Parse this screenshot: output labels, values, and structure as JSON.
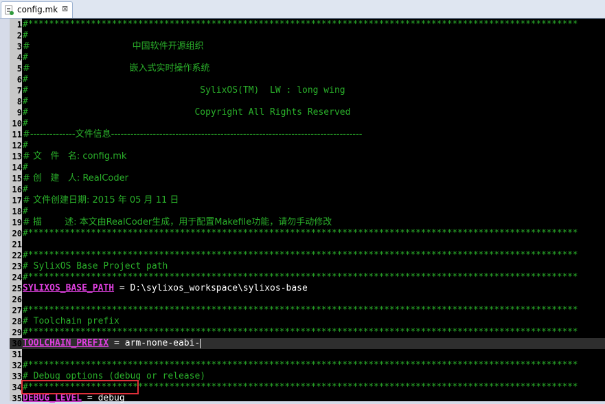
{
  "tab": {
    "title": "config.mk",
    "close": "⊠"
  },
  "lines": [
    {
      "n": "1",
      "kind": "stars",
      "text": "#*********************************************************************************************************"
    },
    {
      "n": "2",
      "kind": "comment",
      "text": "#"
    },
    {
      "n": "3",
      "kind": "comment",
      "text": "#                                    中国软件开源组织"
    },
    {
      "n": "4",
      "kind": "comment",
      "text": "#"
    },
    {
      "n": "5",
      "kind": "comment",
      "text": "#                                   嵌入式实时操作系统"
    },
    {
      "n": "6",
      "kind": "comment",
      "text": "#"
    },
    {
      "n": "7",
      "kind": "comment",
      "text": "#                                SylixOS(TM)  LW : long wing"
    },
    {
      "n": "8",
      "kind": "comment",
      "text": "#"
    },
    {
      "n": "9",
      "kind": "comment",
      "text": "#                               Copyright All Rights Reserved"
    },
    {
      "n": "10",
      "kind": "comment",
      "text": "#"
    },
    {
      "n": "11",
      "kind": "comment",
      "text": "#--------------文件信息------------------------------------------------------------------------------"
    },
    {
      "n": "12",
      "kind": "comment",
      "text": "#"
    },
    {
      "n": "13",
      "kind": "comment",
      "text": "# 文   件   名: config.mk"
    },
    {
      "n": "14",
      "kind": "comment",
      "text": "#"
    },
    {
      "n": "15",
      "kind": "comment",
      "text": "# 创   建   人: RealCoder"
    },
    {
      "n": "16",
      "kind": "comment",
      "text": "#"
    },
    {
      "n": "17",
      "kind": "comment",
      "text": "# 文件创建日期: 2015 年 05 月 11 日"
    },
    {
      "n": "18",
      "kind": "comment",
      "text": "#"
    },
    {
      "n": "19",
      "kind": "comment",
      "text": "# 描        述: 本文由RealCoder生成，用于配置Makefile功能，请勿手动修改"
    },
    {
      "n": "20",
      "kind": "stars",
      "text": "#*********************************************************************************************************"
    },
    {
      "n": "21",
      "kind": "comment",
      "text": ""
    },
    {
      "n": "22",
      "kind": "stars",
      "text": "#*********************************************************************************************************"
    },
    {
      "n": "23",
      "kind": "comment",
      "text": "# SylixOS Base Project path"
    },
    {
      "n": "24",
      "kind": "stars",
      "text": "#*********************************************************************************************************"
    },
    {
      "n": "25",
      "kind": "assign",
      "var": "SYLIXOS_BASE_PATH",
      "value": " = D:\\sylixos_workspace\\sylixos-base"
    },
    {
      "n": "26",
      "kind": "comment",
      "text": ""
    },
    {
      "n": "27",
      "kind": "stars",
      "text": "#*********************************************************************************************************"
    },
    {
      "n": "28",
      "kind": "comment",
      "text": "# Toolchain prefix"
    },
    {
      "n": "29",
      "kind": "stars",
      "text": "#*********************************************************************************************************"
    },
    {
      "n": "30",
      "kind": "assign",
      "var": "TOOLCHAIN_PREFIX",
      "value": " = arm-none-eabi-"
    },
    {
      "n": "31",
      "kind": "comment",
      "text": ""
    },
    {
      "n": "32",
      "kind": "stars",
      "text": "#*********************************************************************************************************"
    },
    {
      "n": "33",
      "kind": "comment",
      "text": "# Debug options (debug or release)"
    },
    {
      "n": "34",
      "kind": "stars",
      "text": "#*********************************************************************************************************"
    },
    {
      "n": "35",
      "kind": "assign",
      "var": "DEBUG_LEVEL",
      "value": " = debug"
    }
  ]
}
